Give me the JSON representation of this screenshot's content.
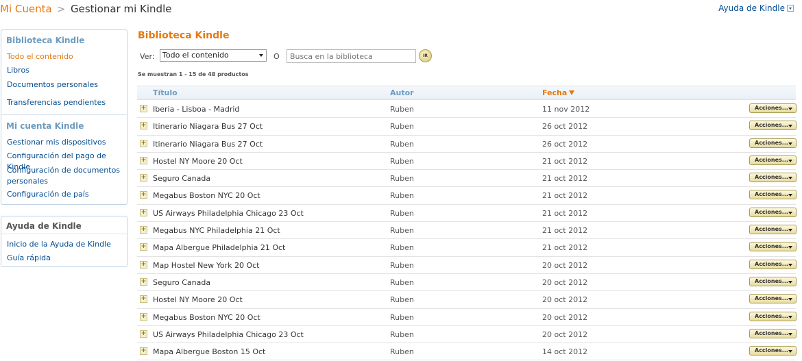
{
  "breadcrumb": {
    "root": "Mi Cuenta",
    "separator": ">",
    "current": "Gestionar mi Kindle"
  },
  "help_top": "Ayuda de Kindle",
  "sidebar": {
    "library": {
      "heading": "Biblioteca Kindle",
      "items": [
        {
          "label": "Todo el contenido"
        },
        {
          "label": "Libros"
        },
        {
          "label": "Documentos personales"
        },
        {
          "label": "Transferencias pendientes"
        }
      ]
    },
    "account": {
      "heading": "Mi cuenta Kindle",
      "items": [
        {
          "label": "Gestionar mis dispositivos"
        },
        {
          "label": "Configuración del pago de Kindle"
        },
        {
          "label": "Configuración de documentos personales"
        },
        {
          "label": "Configuración de país"
        }
      ]
    },
    "help": {
      "heading": "Ayuda de Kindle",
      "items": [
        {
          "label": "Inicio de la Ayuda de Kindle"
        },
        {
          "label": "Guía rápida"
        }
      ]
    }
  },
  "main": {
    "title": "Biblioteca Kindle",
    "ver_label": "Ver:",
    "filter_value": "Todo el contenido",
    "or_label": "O",
    "search_placeholder": "Busca en la biblioteca",
    "go_button": "IR",
    "count_text": "Se muestran 1 - 15 de 48 productos",
    "columns": {
      "titulo": "Título",
      "autor": "Autor",
      "fecha": "Fecha"
    },
    "action_label": "Acciones...",
    "rows": [
      {
        "titulo": "Iberia - Lisboa - Madrid",
        "autor": "Ruben",
        "fecha": "11 nov 2012"
      },
      {
        "titulo": "Itinerario Niagara Bus 27 Oct",
        "autor": "Ruben",
        "fecha": "26 oct 2012"
      },
      {
        "titulo": "Itinerario Niagara Bus 27 Oct",
        "autor": "Ruben",
        "fecha": "26 oct 2012"
      },
      {
        "titulo": "Hostel NY Moore 20 Oct",
        "autor": "Ruben",
        "fecha": "21 oct 2012"
      },
      {
        "titulo": "Seguro Canada",
        "autor": "Ruben",
        "fecha": "21 oct 2012"
      },
      {
        "titulo": "Megabus Boston NYC 20 Oct",
        "autor": "Ruben",
        "fecha": "21 oct 2012"
      },
      {
        "titulo": "US Airways Philadelphia Chicago 23 Oct",
        "autor": "Ruben",
        "fecha": "21 oct 2012"
      },
      {
        "titulo": "Megabus NYC Philadelphia 21 Oct",
        "autor": "Ruben",
        "fecha": "21 oct 2012"
      },
      {
        "titulo": "Mapa Albergue Philadelphia 21 Oct",
        "autor": "Ruben",
        "fecha": "21 oct 2012"
      },
      {
        "titulo": "Map Hostel New York 20 Oct",
        "autor": "Ruben",
        "fecha": "20 oct 2012"
      },
      {
        "titulo": "Seguro Canada",
        "autor": "Ruben",
        "fecha": "20 oct 2012"
      },
      {
        "titulo": "Hostel NY Moore 20 Oct",
        "autor": "Ruben",
        "fecha": "20 oct 2012"
      },
      {
        "titulo": "Megabus Boston NYC 20 Oct",
        "autor": "Ruben",
        "fecha": "20 oct 2012"
      },
      {
        "titulo": "US Airways Philadelphia Chicago 23 Oct",
        "autor": "Ruben",
        "fecha": "20 oct 2012"
      },
      {
        "titulo": "Mapa Albergue Boston 15 Oct",
        "autor": "Ruben",
        "fecha": "14 oct 2012"
      }
    ]
  },
  "colors": {
    "accent_orange": "#e47911",
    "link_blue": "#004b91",
    "heading_blue": "#6d9cc0"
  },
  "icons": {
    "expand": "plus-icon",
    "sort": "sort-desc-icon",
    "dropdown": "chevron-down-icon"
  }
}
